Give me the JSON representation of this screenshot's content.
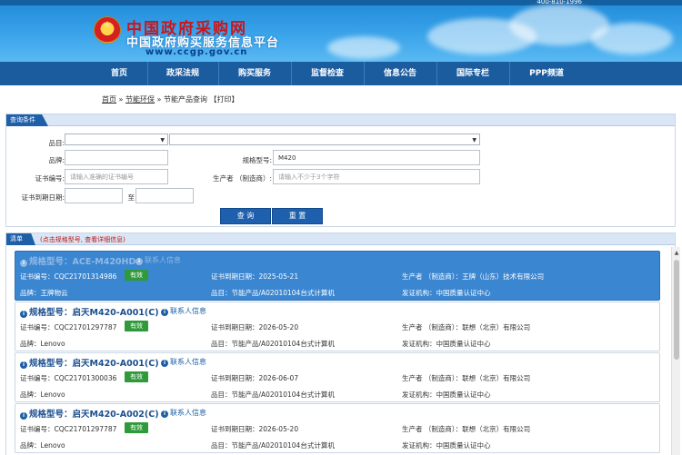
{
  "header": {
    "title": "中国政府采购网",
    "subtitle": "中国政府购买服务信息平台",
    "domain": "www.ccgp.gov.cn",
    "phone": "400-810-1996"
  },
  "nav": {
    "items": [
      {
        "label": "首页"
      },
      {
        "label": "政采法规"
      },
      {
        "label": "购买服务"
      },
      {
        "label": "监督检查"
      },
      {
        "label": "信息公告"
      },
      {
        "label": "国际专栏"
      },
      {
        "label": "PPP频道"
      }
    ]
  },
  "breadcrumb": {
    "home": "首页",
    "sep1": "»",
    "section": "节能环保",
    "sep2": "»",
    "current": "节能产品查询",
    "print": "【打印】"
  },
  "query": {
    "tab": "查询条件",
    "category_label": "品目:",
    "brand_label": "品牌:",
    "model_label": "规格型号:",
    "model_value": "M420",
    "cert_no_label": "证书编号:",
    "cert_no_placeholder": "请输入准确的证书编号",
    "producer_label": "生产者 （制造商）:",
    "producer_placeholder": "请输入不少于3个字符",
    "expiry_label": "证书到期日期:",
    "expiry_to": "至",
    "search_button": "查 询",
    "reset_button": "重 置"
  },
  "list": {
    "tab": "清单",
    "hint": "(点击规格型号, 查看详细信息)",
    "cards": [
      {
        "title": "规格型号：ACE-M420HD",
        "contact": "联系人信息",
        "cert_no": "证书编号：CQC21701314986",
        "status": "有效",
        "expiry": "证书到期日期：2025-05-21",
        "producer": "生产者 （制造商）：王牌（山东）技术有限公司",
        "brand": "品牌：王牌物云",
        "category": "品目：节能产品/A02010104台式计算机",
        "issuer": "发证机构：中国质量认证中心"
      },
      {
        "title": "规格型号：启天M420-A001(C)",
        "contact": "联系人信息",
        "cert_no": "证书编号：CQC21701297787",
        "status": "有效",
        "expiry": "证书到期日期：2026-05-20",
        "producer": "生产者 （制造商）：联想（北京）有限公司",
        "brand": "品牌：Lenovo",
        "category": "品目：节能产品/A02010104台式计算机",
        "issuer": "发证机构：中国质量认证中心"
      },
      {
        "title": "规格型号：启天M420-A001(C)",
        "contact": "联系人信息",
        "cert_no": "证书编号：CQC21701300036",
        "status": "有效",
        "expiry": "证书到期日期：2026-06-07",
        "producer": "生产者 （制造商）：联想（北京）有限公司",
        "brand": "品牌：Lenovo",
        "category": "品目：节能产品/A02010104台式计算机",
        "issuer": "发证机构：中国质量认证中心"
      },
      {
        "title": "规格型号：启天M420-A002(C)",
        "contact": "联系人信息",
        "cert_no": "证书编号：CQC21701297787",
        "status": "有效",
        "expiry": "证书到期日期：2026-05-20",
        "producer": "生产者 （制造商）：联想（北京）有限公司",
        "brand": "品牌：Lenovo",
        "category": "品目：节能产品/A02010104台式计算机",
        "issuer": "发证机构：中国质量认证中心"
      }
    ]
  },
  "colors": {
    "nav_bg": "#1b5c9f",
    "tab_bg": "#1e5fa8",
    "button_bg": "#1e60ae",
    "selected_card": "#3b86d0",
    "badge_green": "#2e9a3a",
    "hint_red": "#c21515",
    "title_red": "#c8161d"
  },
  "icons": {
    "info": "info-circle-icon",
    "emblem": "national-emblem-icon"
  }
}
